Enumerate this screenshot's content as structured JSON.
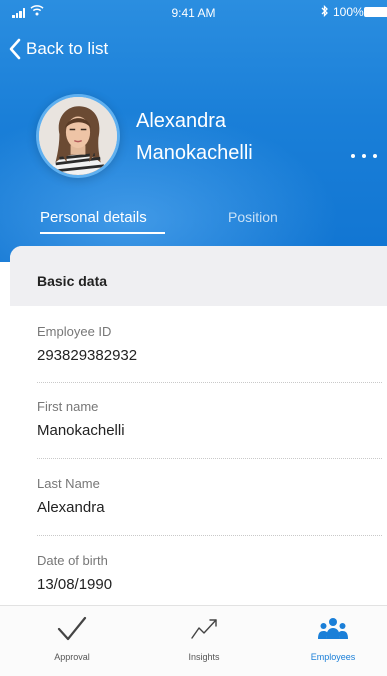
{
  "status_bar": {
    "time": "9:41 AM",
    "battery": "100%"
  },
  "nav": {
    "back_label": "Back to list"
  },
  "profile": {
    "first_line": "Alexandra",
    "second_line": "Manokachelli"
  },
  "tabs": [
    {
      "label": "Personal details",
      "active": true
    },
    {
      "label": "Position",
      "active": false
    }
  ],
  "section": {
    "title": "Basic data",
    "fields": [
      {
        "label": "Employee ID",
        "value": "293829382932"
      },
      {
        "label": "First name",
        "value": "Manokachelli"
      },
      {
        "label": "Last Name",
        "value": "Alexandra"
      },
      {
        "label": "Date of birth",
        "value": "13/08/1990"
      }
    ]
  },
  "tabbar": [
    {
      "label": "Approval",
      "icon": "checkmark-icon",
      "active": false
    },
    {
      "label": "Insights",
      "icon": "trend-line-icon",
      "active": false
    },
    {
      "label": "Employees",
      "icon": "people-group-icon",
      "active": true
    }
  ],
  "colors": {
    "primary": "#1a7fd8",
    "section_bg": "#efeff2",
    "label_gray": "#777777"
  }
}
